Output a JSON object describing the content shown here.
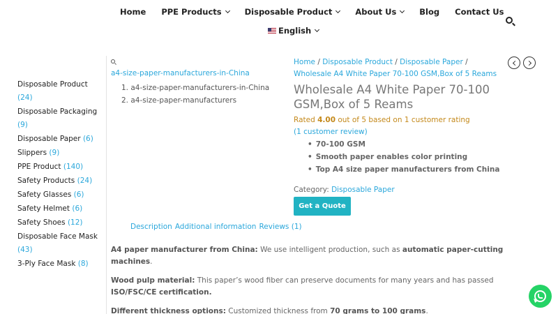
{
  "nav": {
    "items": [
      {
        "label": "Home",
        "dropdown": false
      },
      {
        "label": "PPE Products",
        "dropdown": true
      },
      {
        "label": "Disposable Product",
        "dropdown": true
      },
      {
        "label": "About Us",
        "dropdown": true
      },
      {
        "label": "Blog",
        "dropdown": false
      },
      {
        "label": "Contact Us",
        "dropdown": false
      }
    ],
    "language": "English",
    "search_icon": "search-icon"
  },
  "sidebar": {
    "categories": [
      {
        "label": "Disposable Product",
        "count": "(24)"
      },
      {
        "label": "Disposable Packaging",
        "count": "(9)"
      },
      {
        "label": "Disposable Paper",
        "count": "(6)"
      },
      {
        "label": "Slippers",
        "count": "(9)"
      },
      {
        "label": "PPE Product",
        "count": "(140)"
      },
      {
        "label": "Safety Products",
        "count": "(24)"
      },
      {
        "label": "Safety Glasses",
        "count": "(6)"
      },
      {
        "label": "Safety Helmet",
        "count": "(6)"
      },
      {
        "label": "Safety Shoes",
        "count": "(12)"
      },
      {
        "label": "Disposable Face Mask",
        "count": "(43)"
      },
      {
        "label": "3-Ply Face Mask",
        "count": "(8)"
      }
    ]
  },
  "gallery": {
    "zoom_icon": "zoom-icon",
    "image_alt": "a4-size-paper-manufacturers-in-China",
    "thumbnails": [
      "a4-size-paper-manufacturers-in-China",
      "a4-size-paper-manufacturers"
    ]
  },
  "product": {
    "breadcrumb": {
      "home": "Home",
      "sep": " / ",
      "level1": "Disposable Product",
      "level2": "Disposable Paper",
      "current": "Wholesale A4 White Paper 70-100 GSM,Box of 5 Reams"
    },
    "title": "Wholesale A4 White Paper 70-100 GSM,Box of 5 Reams",
    "rating_prefix": "Rated ",
    "rating_value": "4.00",
    "rating_suffix": " out of 5 based on ",
    "rating_count": "1",
    "rating_tail": " customer rating",
    "review_link": "(1 customer review)",
    "features": [
      "70-100 GSM",
      "Smooth paper enables color printing",
      "Top A4 size paper manufacturers from China"
    ],
    "category_label": "Category: ",
    "category_value": "Disposable Paper",
    "quote_button": "Get a Quote"
  },
  "tabs": {
    "description": "Description",
    "additional": "Additional information",
    "reviews": "Reviews (1)"
  },
  "description": {
    "p1_label": "A4 paper manufacturer from China:",
    "p1_text": " We use intelligent production, such as ",
    "p1_bold": "automatic paper-cutting machines",
    "p1_end": ".",
    "p2_label": "Wood pulp material:",
    "p2_text": " This paper’s wood fiber can preserve documents for many years and has passed ",
    "p2_bold": "ISO/FSC/CE certification.",
    "p3_label": "Different thickness options:",
    "p3_text": " Customized thickness from ",
    "p3_bold": "70 grams to 100 grams",
    "p3_end": "."
  },
  "colors": {
    "accent_link": "#2aa7db",
    "quote_button": "#21b3c3",
    "rating": "#c4891b",
    "whatsapp": "#25d366"
  }
}
